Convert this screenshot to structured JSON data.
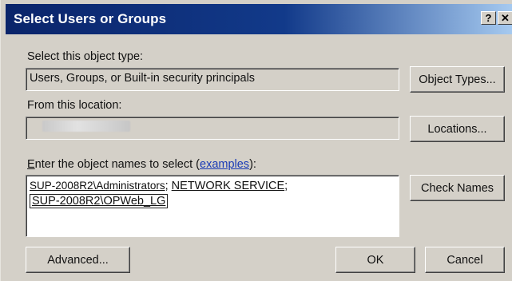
{
  "window": {
    "title": "Select Users or Groups",
    "help_button": "?",
    "close_button": "✕"
  },
  "object_type": {
    "label": "Select this object type:",
    "value": "Users, Groups, or Built-in security principals",
    "button": "Object Types..."
  },
  "location": {
    "label": "From this location:",
    "value": "",
    "button": "Locations..."
  },
  "names": {
    "label_first_char": "E",
    "label_rest": "nter the object names to select (",
    "link": "examples",
    "label_end": "):",
    "entries": [
      {
        "text": "SUP-2008R2\\Administrators",
        "sep": "; "
      },
      {
        "text": "NETWORK SERVICE",
        "sep": ";"
      },
      {
        "text": "SUP-2008R2\\OPWeb_LG",
        "sep": ""
      }
    ],
    "check_button": "Check Names"
  },
  "footer": {
    "advanced_button": "Advanced...",
    "ok_button": "OK",
    "cancel_button": "Cancel"
  },
  "colors": {
    "title_start": "#0a246a",
    "title_end": "#a6caf0",
    "face": "#d4d0c8",
    "link": "#1a3bb6"
  }
}
